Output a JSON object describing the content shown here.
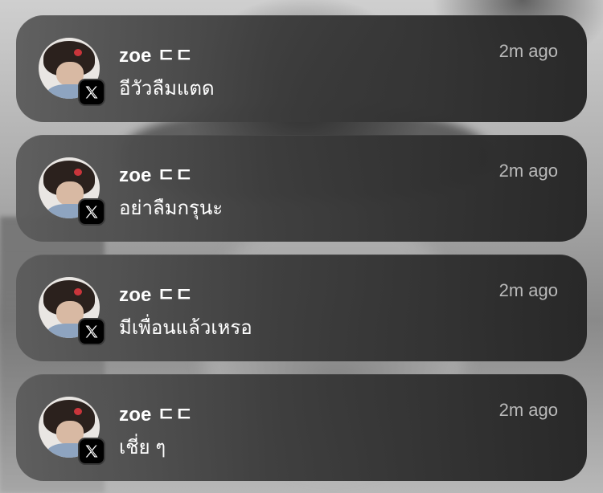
{
  "notifications": [
    {
      "sender": "zoe ㄷㄷ",
      "time": "2m ago",
      "message": "อีวัวลืมแตด",
      "app_icon": "x-logo-icon",
      "avatar": "profile-photo"
    },
    {
      "sender": "zoe ㄷㄷ",
      "time": "2m ago",
      "message": "อย่าลืมกรุนะ",
      "app_icon": "x-logo-icon",
      "avatar": "profile-photo"
    },
    {
      "sender": "zoe ㄷㄷ",
      "time": "2m ago",
      "message": "มีเพื่อนแล้วเหรอ",
      "app_icon": "x-logo-icon",
      "avatar": "profile-photo"
    },
    {
      "sender": "zoe ㄷㄷ",
      "time": "2m ago",
      "message": "เชี่ย ๆ",
      "app_icon": "x-logo-icon",
      "avatar": "profile-photo"
    }
  ],
  "colors": {
    "card_left": "#5c5c5c",
    "card_right": "#262626",
    "sender_text": "#ffffff",
    "time_text": "#b9b9b9",
    "badge_bg": "#000000"
  }
}
